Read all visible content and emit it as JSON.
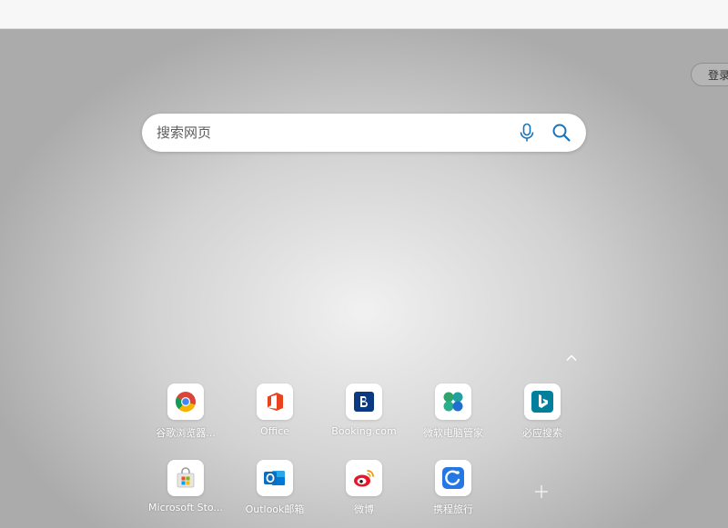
{
  "header": {
    "login_label": "登录"
  },
  "search": {
    "placeholder": "搜索网页"
  },
  "tiles": [
    {
      "label": "谷歌浏览器...",
      "icon": "chrome-icon"
    },
    {
      "label": "Office",
      "icon": "office-icon"
    },
    {
      "label": "Booking.com",
      "icon": "booking-icon"
    },
    {
      "label": "微软电脑管家",
      "icon": "pc-manager-icon"
    },
    {
      "label": "必应搜索",
      "icon": "bing-icon"
    },
    {
      "label": "Microsoft Sto...",
      "icon": "microsoft-store-icon"
    },
    {
      "label": "Outlook邮箱",
      "icon": "outlook-icon"
    },
    {
      "label": "微博",
      "icon": "weibo-icon"
    },
    {
      "label": "携程旅行",
      "icon": "ctrip-icon"
    }
  ],
  "colors": {
    "accent": "#1a73b8",
    "office_red": "#e8431f",
    "booking_blue": "#0b3a82",
    "bing_teal": "#00809d",
    "outlook_blue": "#0f6cbd"
  }
}
